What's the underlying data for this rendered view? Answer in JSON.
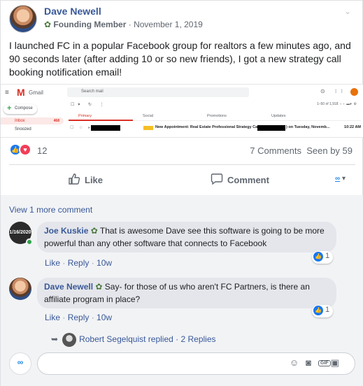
{
  "post": {
    "author": "Dave Newell",
    "badge": "Founding Member",
    "date": "November 1, 2019",
    "text": "I launched FC in a popular Facebook group for realtors a few minutes ago, and 90 seconds later (after adding 10 or so new friends), I got a new strategy call booking notification email!"
  },
  "gmail": {
    "brand": "Gmail",
    "search_placeholder": "Search mail",
    "compose": "Compose",
    "inbox": "Inbox",
    "inbox_count": "468",
    "snoozed": "Snoozed",
    "pages": "1–50 of 1,918",
    "tabs": [
      "Primary",
      "Social",
      "Promotions",
      "Updates"
    ],
    "email_subject": "New Appointment: Real Estate Professional Strategy Call (Phone) (",
    "email_subject_end": ") on Tuesday, Novemb...",
    "email_time": "10:22 AM",
    "label_color": "#f6bf26"
  },
  "reactions": {
    "count": "12",
    "comments": "7 Comments",
    "seen": "Seen by 59"
  },
  "actions": {
    "like": "Like",
    "comment": "Comment"
  },
  "comments": {
    "view_more": "View 1 more comment",
    "items": [
      {
        "author": "Joe Kuskie",
        "avatar_text": "1/16/2020",
        "text": "That is awesome Dave see this software is going to be more powerful than any other software that connects to Facebook",
        "like": "Like",
        "reply": "Reply",
        "time": "10w",
        "reactions": "1"
      },
      {
        "author": "Dave Newell",
        "text": "Say- for those of us who aren't FC Partners, is there an affiliate program in place?",
        "like": "Like",
        "reply": "Reply",
        "time": "10w",
        "reactions": "1"
      }
    ],
    "replied": "Robert Segelquist replied · 2 Replies"
  },
  "colors": {
    "link": "#385898",
    "like_blue": "#1877f2",
    "love_red": "#f33e58",
    "gmail_red": "#d93025"
  }
}
